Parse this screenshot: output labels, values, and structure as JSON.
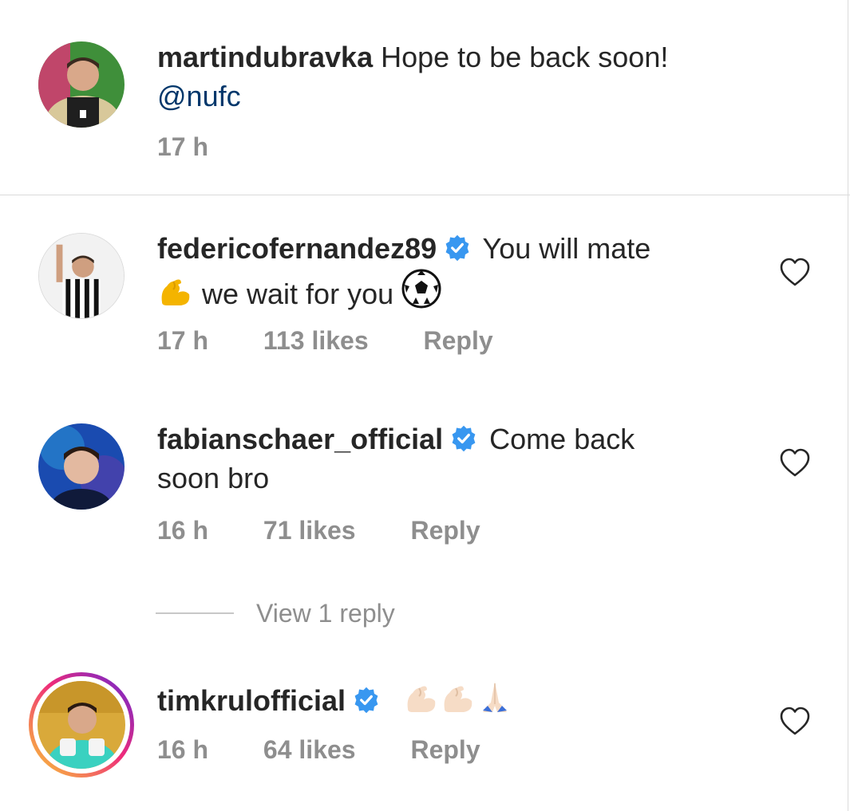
{
  "caption": {
    "username": "martindubravka",
    "text": "Hope to be back soon!",
    "mention": "@nufc",
    "time": "17 h"
  },
  "comments": [
    {
      "username": "federicofernandez89",
      "verified": true,
      "text_line1": "You will mate",
      "text_line2": "we wait for you",
      "emojis": [
        "flexed-biceps",
        "soccer-ball"
      ],
      "time": "17 h",
      "likes": "113 likes",
      "reply": "Reply"
    },
    {
      "username": "fabianschaer_official",
      "verified": true,
      "text_line1": "Come back",
      "text_line2": "soon bro",
      "time": "16 h",
      "likes": "71 likes",
      "reply": "Reply",
      "view_replies": "View 1 reply"
    },
    {
      "username": "timkrulofficial",
      "verified": true,
      "emojis": [
        "flexed-biceps-light",
        "flexed-biceps-light",
        "folded-hands-light"
      ],
      "time": "16 h",
      "likes": "64 likes",
      "reply": "Reply"
    }
  ],
  "colors": {
    "text": "#262626",
    "secondary": "#8e8e8e",
    "mention": "#00376b",
    "verified": "#3897f0"
  }
}
